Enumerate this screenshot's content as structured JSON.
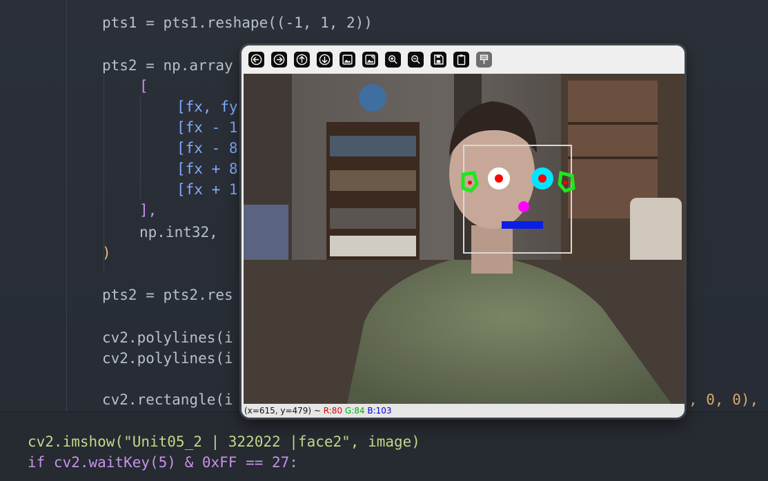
{
  "editor": {
    "lines": [
      {
        "id": "l1",
        "text": "pts1 = pts1.reshape((-1, 1, 2))"
      },
      {
        "id": "l2",
        "text": "pts2 = np.array"
      },
      {
        "id": "l3",
        "text": "["
      },
      {
        "id": "l4",
        "text": "[fx, fy"
      },
      {
        "id": "l5",
        "text": "[fx - 1"
      },
      {
        "id": "l6",
        "text": "[fx - 8"
      },
      {
        "id": "l7",
        "text": "[fx + 8"
      },
      {
        "id": "l8",
        "text": "[fx + 1"
      },
      {
        "id": "l9",
        "text": "],"
      },
      {
        "id": "l10",
        "text": "np.int32,"
      },
      {
        "id": "l11",
        "text": ")"
      },
      {
        "id": "l12",
        "text": "pts2 = pts2.res"
      },
      {
        "id": "l13",
        "text": "cv2.polylines(i"
      },
      {
        "id": "l14",
        "text": "cv2.polylines(i"
      },
      {
        "id": "l15",
        "text": "cv2.rectangle(i"
      },
      {
        "id": "l15b",
        "text": ", 0, 0),"
      }
    ],
    "bottom": {
      "imshow": "cv2.imshow(\"Unit05_2 | 322022 |face2\", image)",
      "waitkey": "if cv2.waitKey(5) & 0xFF == 27:"
    }
  },
  "window": {
    "toolbar": [
      {
        "name": "arrow-left-icon",
        "label": "Pan left"
      },
      {
        "name": "arrow-right-icon",
        "label": "Pan right"
      },
      {
        "name": "arrow-up-icon",
        "label": "Pan up"
      },
      {
        "name": "arrow-down-icon",
        "label": "Pan down"
      },
      {
        "name": "image-icon",
        "label": "Zoom original"
      },
      {
        "name": "image-fit-icon",
        "label": "Zoom fit"
      },
      {
        "name": "zoom-in-icon",
        "label": "Zoom in"
      },
      {
        "name": "zoom-out-icon",
        "label": "Zoom out"
      },
      {
        "name": "save-icon",
        "label": "Save"
      },
      {
        "name": "clipboard-icon",
        "label": "Copy"
      },
      {
        "name": "properties-icon",
        "label": "Properties"
      }
    ],
    "status": {
      "coords": "(x=615, y=479) ~ ",
      "r": "R:80",
      "g": "G:84",
      "b": "B:103"
    },
    "overlay_colors": {
      "face_box": "#d8d8d8",
      "left_eye": "#ffffff",
      "right_eye": "#00e5ff",
      "pupil": "#ff0000",
      "nose": "#ff00ff",
      "mouth": "#0a1ee6",
      "ear_marks": "#1ee61e"
    }
  }
}
